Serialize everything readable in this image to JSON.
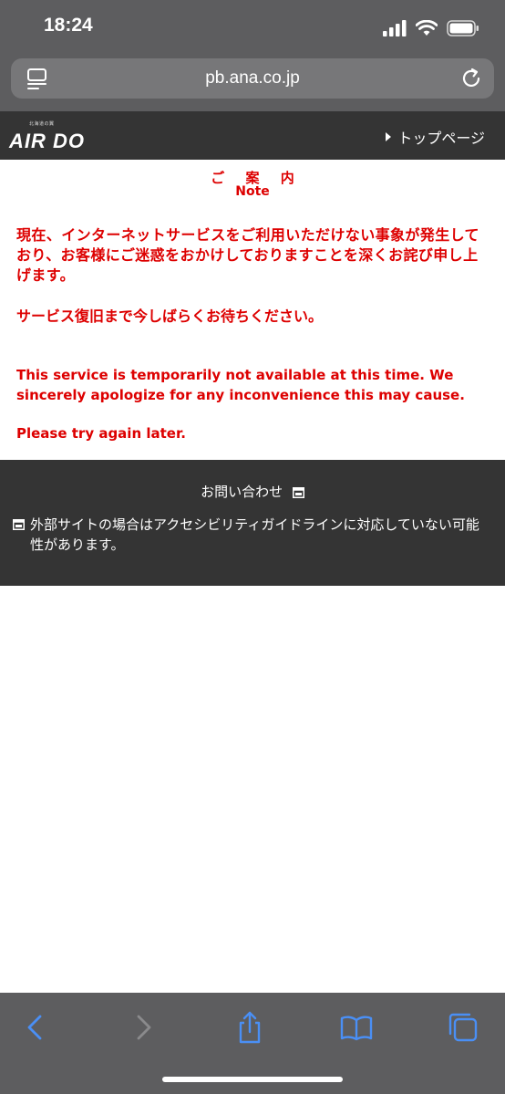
{
  "status_bar": {
    "time": "18:24"
  },
  "browser": {
    "url": "pb.ana.co.jp"
  },
  "site_header": {
    "logo_tagline": "北海道の翼",
    "logo_text": "AIR DO",
    "top_page_link": "トップページ"
  },
  "notice": {
    "title": "ご 案 内",
    "subtitle": "Note",
    "japanese_message": "現在、インターネットサービスをご利用いただけない事象が発生しており、お客様にご迷惑をおかけしておりますことを深くお詫び申し上げます。",
    "japanese_wait": "サービス復旧まで今しばらくお待ちください。",
    "english_message": "This service is temporarily not available at this time. We sincerely apologize for any inconvenience this may cause.",
    "english_retry": "Please try again later."
  },
  "footer": {
    "contact_link": "お問い合わせ",
    "external_site_note": "外部サイトの場合はアクセシビリティガイドラインに対応していない可能性があります。"
  },
  "colors": {
    "notice_red": "#dd0000",
    "header_bg": "#343434",
    "chrome_bg": "#5d5d5f",
    "toolbar_blue": "#4a8ff5"
  }
}
